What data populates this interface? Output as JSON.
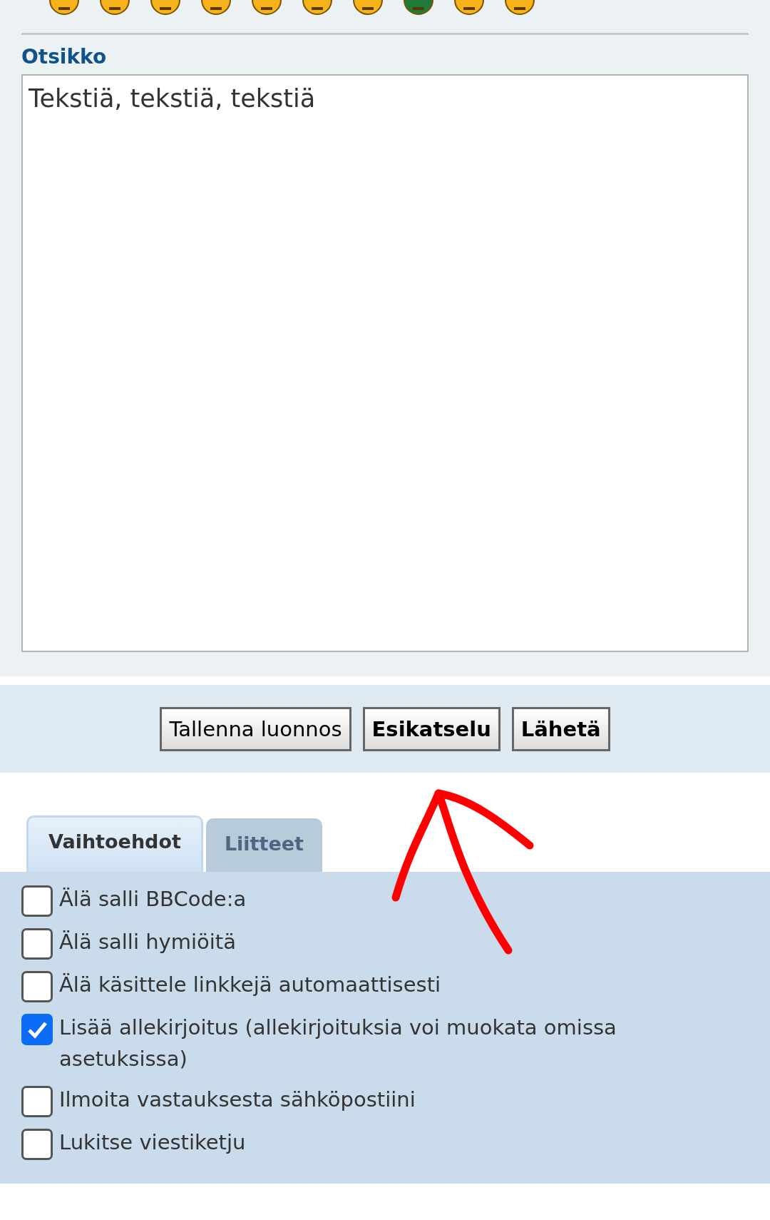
{
  "smilies": [
    {
      "color": "#f5b21a"
    },
    {
      "color": "#f5b21a"
    },
    {
      "color": "#f5b21a"
    },
    {
      "color": "#f5b21a"
    },
    {
      "color": "#f5b21a"
    },
    {
      "color": "#f5b21a"
    },
    {
      "color": "#f5b21a"
    },
    {
      "color": "#1f7a3a"
    },
    {
      "color": "#f5b21a"
    },
    {
      "color": "#f5b21a"
    }
  ],
  "subject": {
    "label": "Otsikko",
    "value": "Tekstiä, tekstiä, tekstiä"
  },
  "buttons": [
    {
      "label": "Tallenna luonnos",
      "primary": false
    },
    {
      "label": "Esikatselu",
      "primary": true
    },
    {
      "label": "Lähetä",
      "primary": true
    }
  ],
  "tabs": [
    {
      "label": "Vaihtoehdot",
      "selected": true
    },
    {
      "label": "Liitteet",
      "selected": false
    }
  ],
  "options": [
    {
      "label": "Älä salli BBCode:a",
      "checked": false
    },
    {
      "label": "Älä salli hymiöitä",
      "checked": false
    },
    {
      "label": "Älä käsittele linkkejä automaattisesti",
      "checked": false
    },
    {
      "label": "Lisää allekirjoitus (allekirjoituksia voi muokata omissa asetuksissa)",
      "checked": true
    },
    {
      "label": "Ilmoita vastauksesta sähköpostiini",
      "checked": false
    },
    {
      "label": "Lukitse viestiketju",
      "checked": false
    }
  ]
}
